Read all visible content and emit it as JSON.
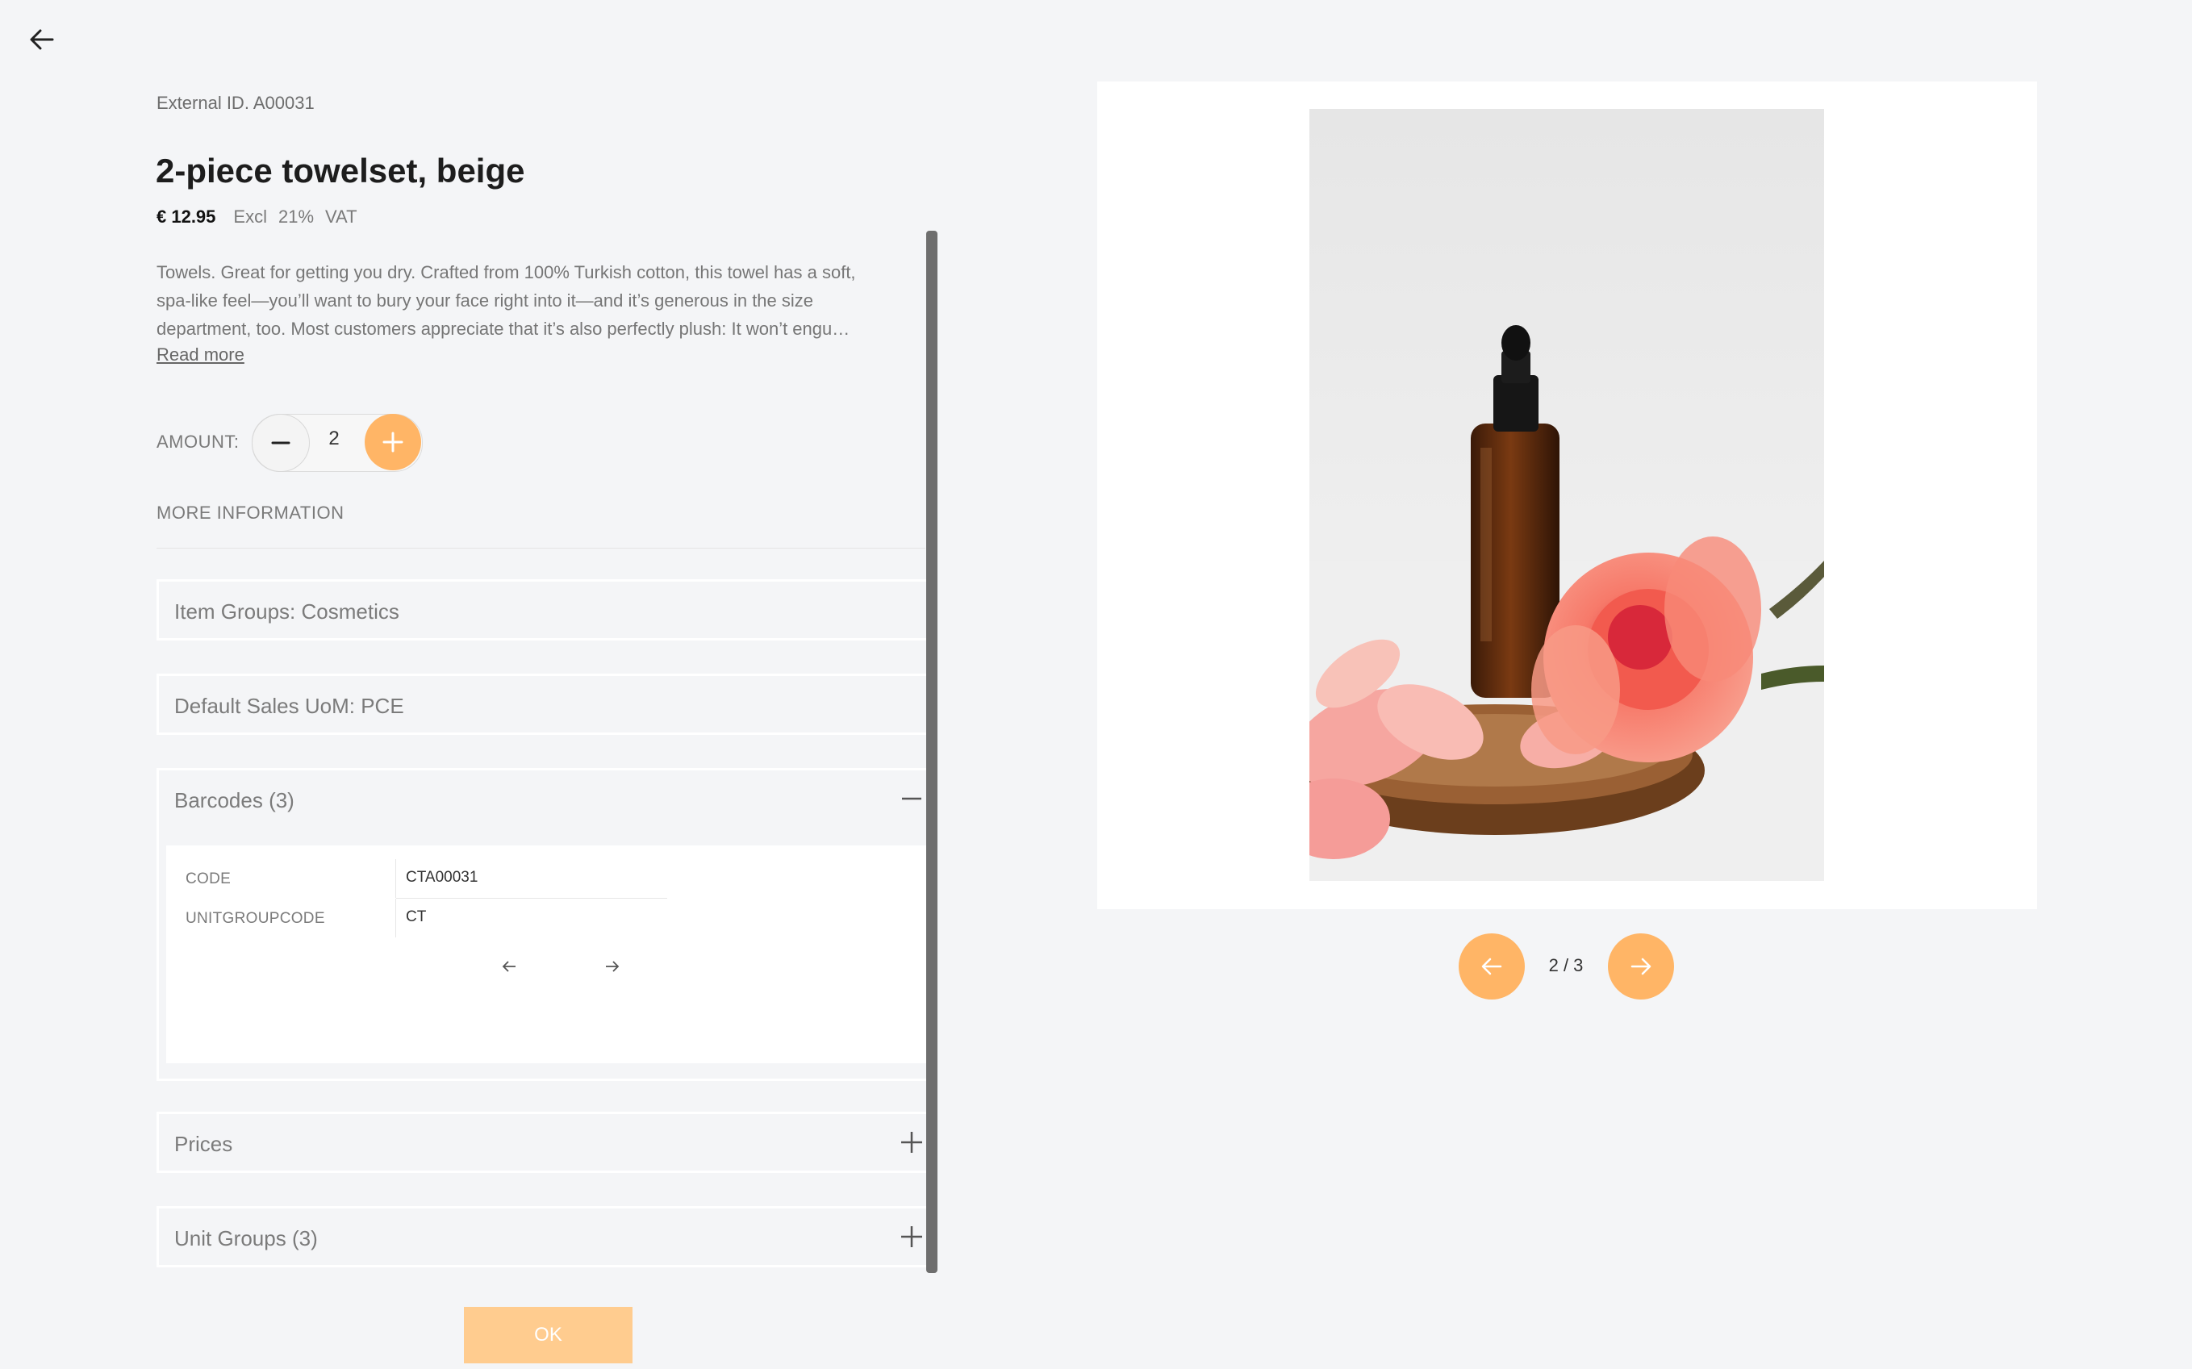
{
  "header": {
    "back_icon": "arrow-left-icon"
  },
  "product": {
    "external_id": "External ID. A00031",
    "title": "2-piece towelset, beige",
    "price": "€ 12.95",
    "vat_excl": "Excl",
    "vat_pct": "21%",
    "vat": "VAT",
    "description_lines": [
      "Towels. Great for getting you dry. Crafted from 100% Turkish cotton, this towel has a soft,",
      "spa-like feel—you’ll want to bury your face right into it—and it’s generous in the size",
      "department, too. Most customers appreciate that it’s also perfectly plush: It won’t engu…"
    ],
    "read_more": "Read more"
  },
  "amount": {
    "label": "AMOUNT:",
    "value": "2"
  },
  "more_info": {
    "label": "MORE INFORMATION",
    "sections": {
      "item_groups": "Item Groups: Cosmetics",
      "default_uom": "Default Sales UoM: PCE",
      "barcodes": "Barcodes (3)",
      "prices": "Prices",
      "unit_groups": "Unit Groups (3)"
    },
    "barcode_rows": [
      {
        "key": "CODE",
        "value": "CTA00031"
      },
      {
        "key": "UNITGROUPCODE",
        "value": "CT"
      }
    ]
  },
  "footer": {
    "ok_label": "OK"
  },
  "gallery": {
    "pager": "2 / 3"
  },
  "colors": {
    "accent": "#ffb566",
    "accent_light": "#ffcc8f",
    "background": "#f4f5f7"
  }
}
